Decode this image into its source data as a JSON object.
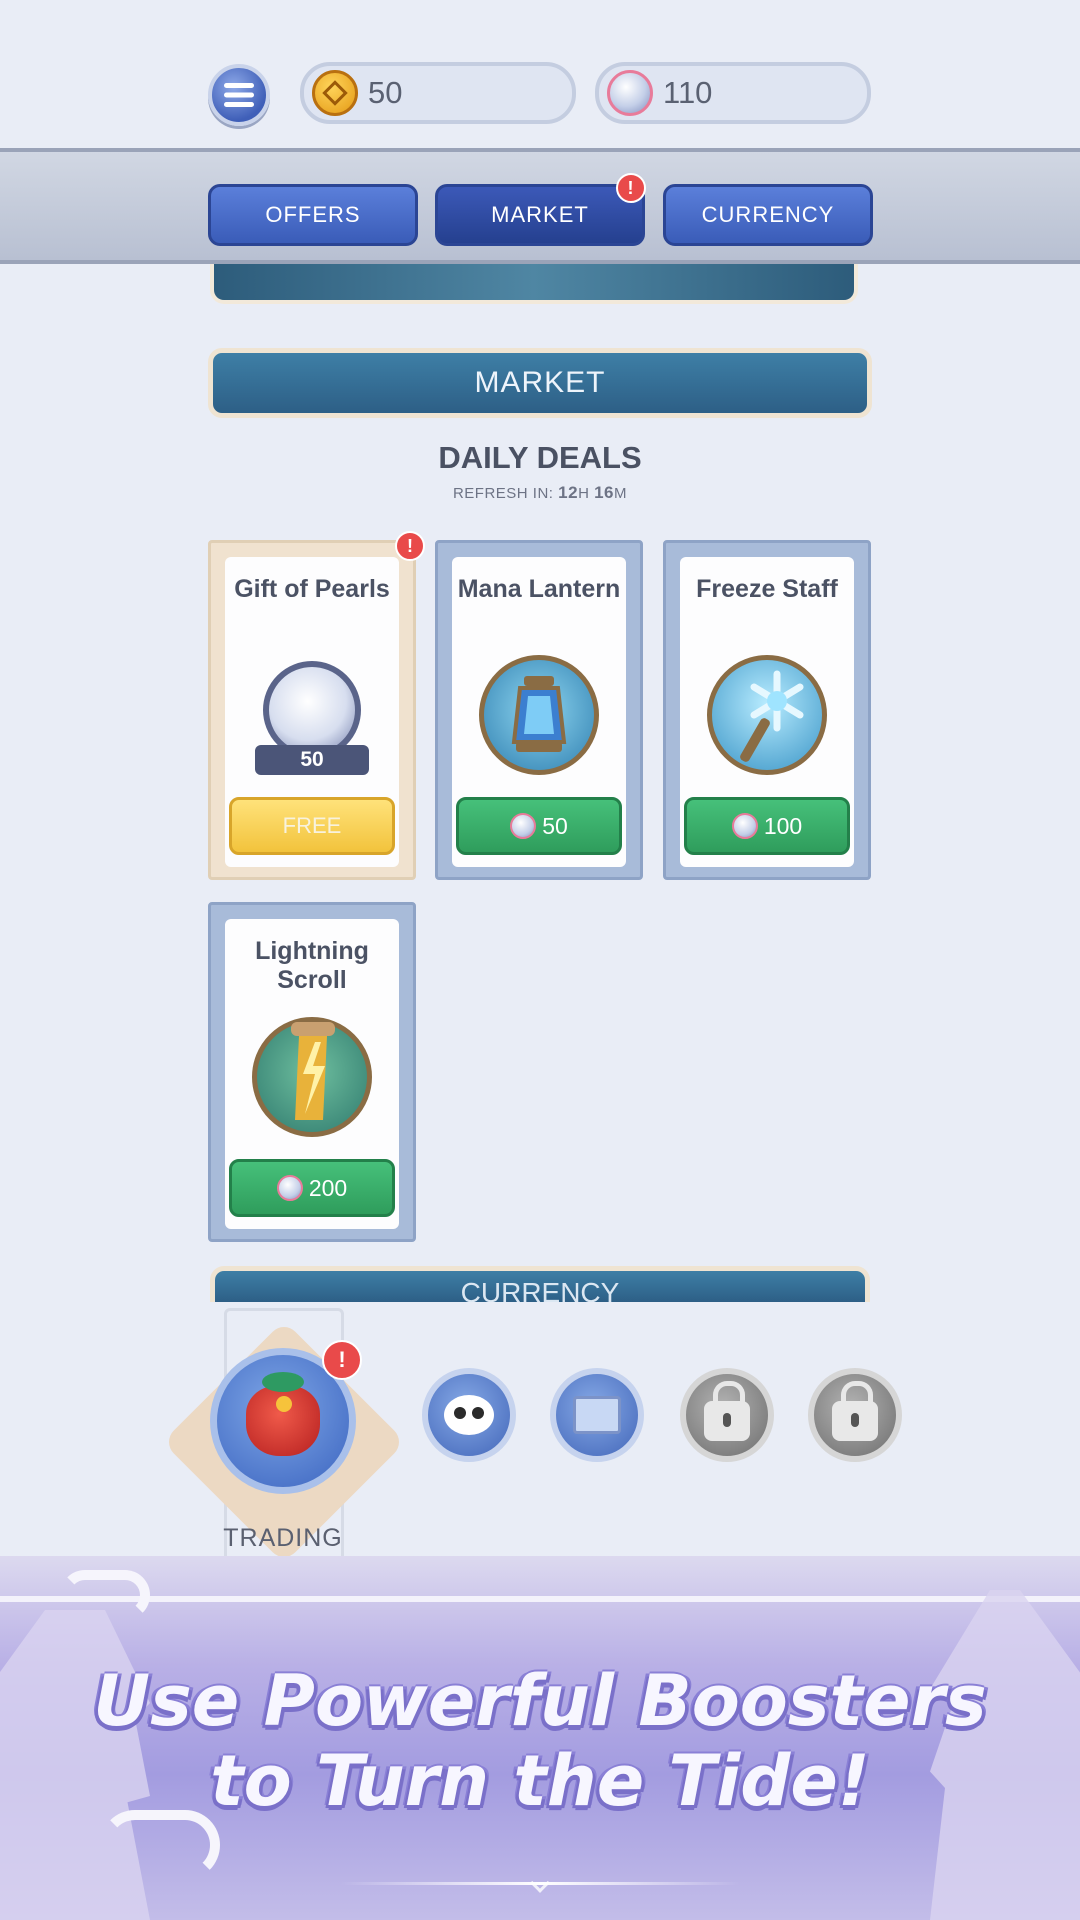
{
  "resources": {
    "coins": "50",
    "pearls": "110"
  },
  "tabs": {
    "offers": "OFFERS",
    "market": "MARKET",
    "currency": "CURRENCY",
    "alert": "!"
  },
  "market": {
    "header": "MARKET",
    "daily_deals": "DAILY DEALS",
    "refresh_label": "REFRESH IN:",
    "refresh_hours": "12",
    "refresh_h_unit": "H",
    "refresh_minutes": "16",
    "refresh_m_unit": "M"
  },
  "deals": [
    {
      "name": "Gift of Pearls",
      "amount": "50",
      "price": "FREE",
      "alert": "!"
    },
    {
      "name": "Mana Lantern",
      "price": "50"
    },
    {
      "name": "Freeze Staff",
      "price": "100"
    },
    {
      "name": "Lightning Scroll",
      "price": "200"
    }
  ],
  "next_section": "CURRENCY",
  "bottom_nav": {
    "selected_label": "TRADING",
    "alert": "!",
    "icons": [
      "trading-bag-icon",
      "panda-icon",
      "map-scroll-icon",
      "lock-icon",
      "lock-icon"
    ]
  },
  "promo": {
    "line1": "Use Powerful Boosters",
    "line2": "to Turn the Tide!"
  }
}
